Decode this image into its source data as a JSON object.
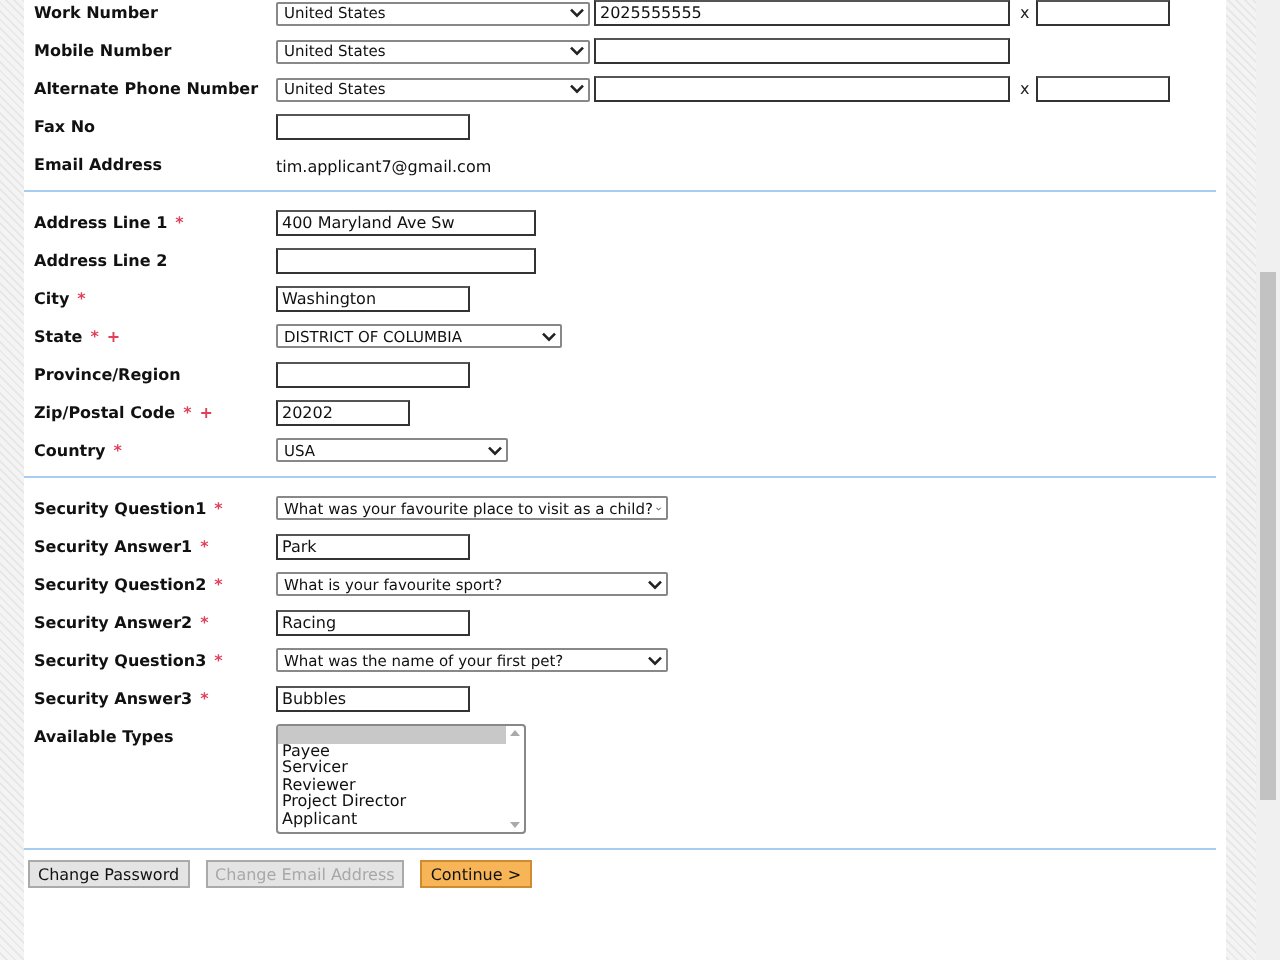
{
  "sections": [
    {
      "fields": [
        {
          "kind": "phone",
          "label": "Work Number",
          "country": "United States",
          "value": "2025555555",
          "ext_label": "x"
        },
        {
          "kind": "phone",
          "label": "Mobile Number",
          "country": "United States"
        },
        {
          "kind": "phone",
          "label": "Alternate Phone Number",
          "country": "United States",
          "ext_label": "x"
        },
        {
          "kind": "input",
          "label": "Fax No"
        },
        {
          "kind": "static",
          "label": "Email Address",
          "value": "tim.applicant7@gmail.com"
        }
      ]
    },
    {
      "fields": [
        {
          "kind": "input",
          "label": "Address Line 1",
          "marks": [
            "*"
          ],
          "value": "400 Maryland Ave Sw"
        },
        {
          "kind": "input",
          "label": "Address Line 2"
        },
        {
          "kind": "input",
          "label": "City",
          "marks": [
            "*"
          ],
          "value": "Washington"
        },
        {
          "kind": "select",
          "label": "State",
          "marks": [
            "*",
            "+"
          ],
          "value": "DISTRICT OF COLUMBIA"
        },
        {
          "kind": "input",
          "label": "Province/Region"
        },
        {
          "kind": "input",
          "label": "Zip/Postal Code",
          "marks": [
            "*",
            "+"
          ],
          "value": "20202"
        },
        {
          "kind": "select",
          "label": "Country",
          "marks": [
            "*"
          ],
          "value": "USA"
        }
      ]
    },
    {
      "fields": [
        {
          "kind": "select",
          "label": "Security Question1",
          "marks": [
            "*"
          ],
          "value": "What was your favourite place to visit as a child?"
        },
        {
          "kind": "input",
          "label": "Security Answer1",
          "marks": [
            "*"
          ],
          "value": "Park"
        },
        {
          "kind": "select",
          "label": "Security Question2",
          "marks": [
            "*"
          ],
          "value": "What is your favourite sport?"
        },
        {
          "kind": "input",
          "label": "Security Answer2",
          "marks": [
            "*"
          ],
          "value": "Racing"
        },
        {
          "kind": "select",
          "label": "Security Question3",
          "marks": [
            "*"
          ],
          "value": "What was the name of your first pet?"
        },
        {
          "kind": "input",
          "label": "Security Answer3",
          "marks": [
            "*"
          ],
          "value": "Bubbles"
        },
        {
          "kind": "listbox",
          "label": "Available Types",
          "blank_option_selected": true,
          "options": [
            {
              "label": "Payee",
              "selected": false
            },
            {
              "label": "Servicer",
              "selected": false
            },
            {
              "label": "Reviewer",
              "selected": false
            },
            {
              "label": "Project Director",
              "selected": false
            },
            {
              "label": "Applicant",
              "selected": false
            }
          ]
        }
      ]
    }
  ],
  "buttons": [
    {
      "label": "Change Password",
      "kind": "normal",
      "disabled": false
    },
    {
      "label": "Change Email Address",
      "kind": "normal",
      "disabled": true
    },
    {
      "label": "Continue >",
      "kind": "primary",
      "disabled": false
    }
  ]
}
